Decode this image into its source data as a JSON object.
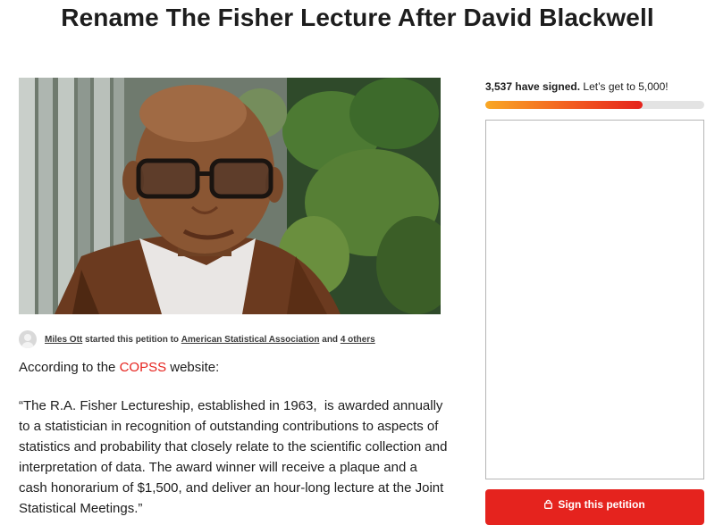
{
  "page": {
    "title": "Rename The Fisher Lecture After David Blackwell"
  },
  "starter": {
    "name": "Miles Ott",
    "started_text": " started this petition to ",
    "target": "American Statistical Association",
    "and_text": " and ",
    "others": "4 others"
  },
  "content": {
    "intro_prefix": "According to the ",
    "intro_link": "COPSS",
    "intro_suffix": " website:",
    "quote": "“The R.A. Fisher Lectureship, established in 1963,  is awarded annually to a statistician in recognition of outstanding contributions to aspects of statistics and probability that closely relate to the scientific collection and interpretation of data. The award winner will receive a plaque and a cash honorarium of $1,500, and deliver an hour-long lecture at the Joint Statistical Meetings.”"
  },
  "signatures": {
    "count_text": "3,537 have signed.",
    "goal_text": " Let’s get to 5,000!",
    "signed": 3537,
    "goal": 5000,
    "progress_fraction": 0.72
  },
  "sign_button": {
    "label": "Sign this petition"
  },
  "colors": {
    "accent_red": "#e5231e",
    "progress_start": "#f9a825",
    "progress_end": "#e5231c"
  },
  "icons": {
    "avatar": "user-avatar-placeholder",
    "lock": "lock-icon"
  }
}
